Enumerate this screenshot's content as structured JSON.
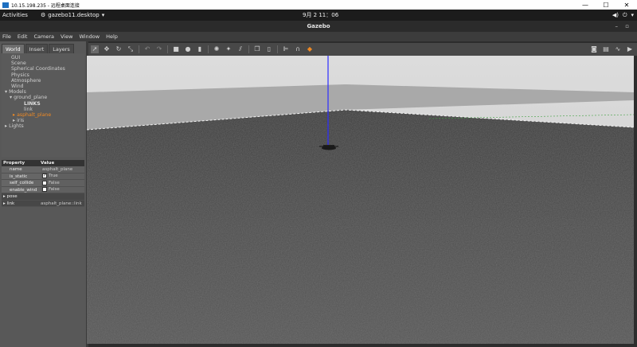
{
  "remote": {
    "title": "10.15.198.235 - 远程桌面连接",
    "min": "—",
    "max": "☐",
    "close": "✕"
  },
  "gnome": {
    "activities": "Activities",
    "app_name": "gazebo11.desktop",
    "clock": "9月 2 11：06"
  },
  "window": {
    "title": "Gazebo"
  },
  "menu": [
    "File",
    "Edit",
    "Camera",
    "View",
    "Window",
    "Help"
  ],
  "tabs": [
    "World",
    "Insert",
    "Layers"
  ],
  "tree": {
    "items": [
      "GUI",
      "Scene",
      "Spherical Coordinates",
      "Physics",
      "Atmosphere",
      "Wind"
    ],
    "models": "Models",
    "ground_plane": "ground_plane",
    "links": "LINKS",
    "link": "link",
    "asphalt_plane": "asphalt_plane",
    "iris": "iris",
    "lights": "Lights"
  },
  "props": {
    "header": [
      "Property",
      "Value"
    ],
    "rows": [
      {
        "key": "name",
        "value": "asphalt_plane"
      },
      {
        "key": "is_static",
        "value": "True"
      },
      {
        "key": "self_collide",
        "value": "False"
      },
      {
        "key": "enable_wind",
        "value": "False"
      }
    ],
    "pose": "pose",
    "link_key": "link",
    "link_value": "asphalt_plane::link"
  },
  "colors": {
    "selected": "#f08a24",
    "z_axis": "#2c2cff"
  }
}
